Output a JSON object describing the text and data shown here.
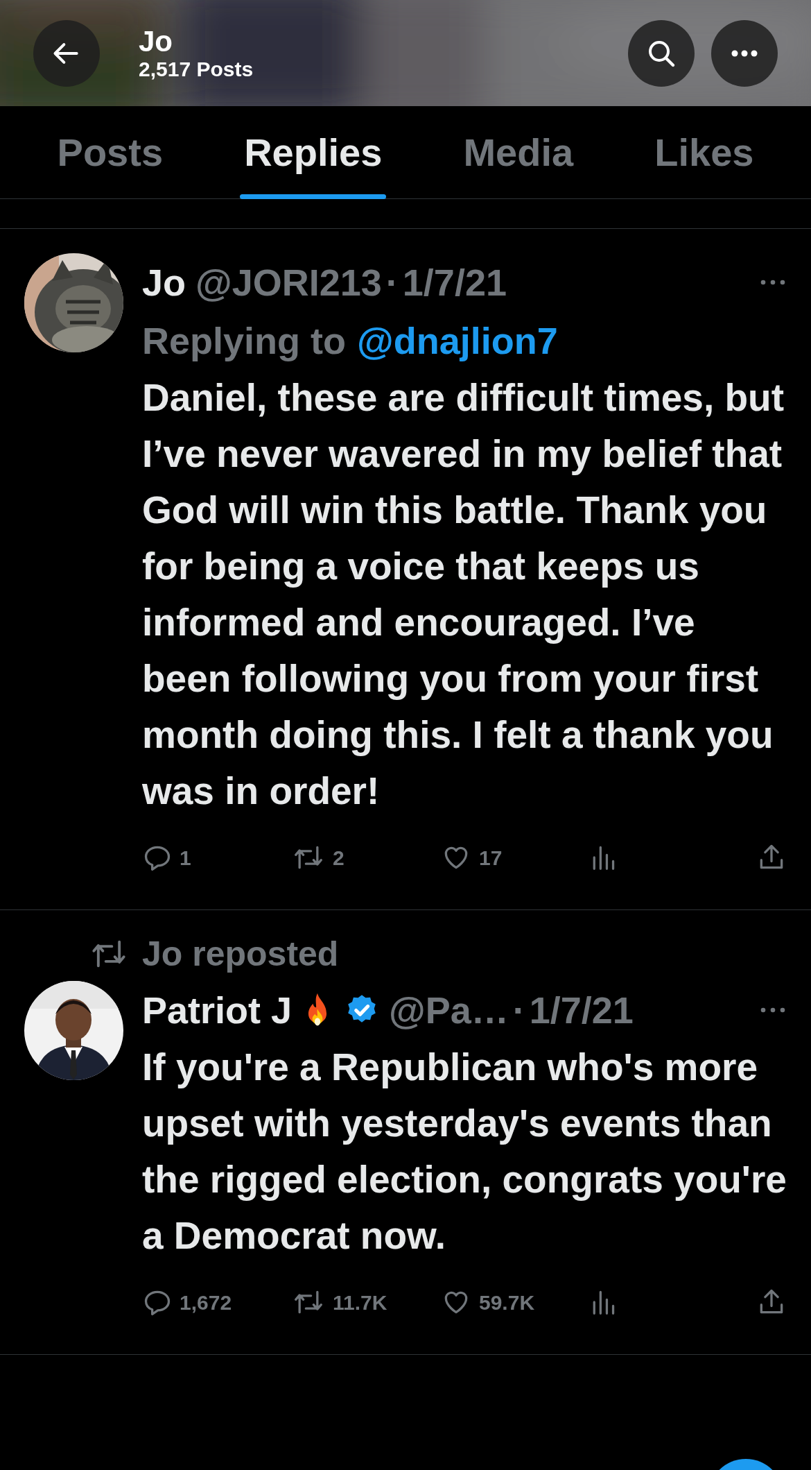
{
  "header": {
    "title": "Jo",
    "subtitle": "2,517 Posts"
  },
  "tabs": [
    {
      "label": "Posts",
      "selected": false
    },
    {
      "label": "Replies",
      "selected": true
    },
    {
      "label": "Media",
      "selected": false
    },
    {
      "label": "Likes",
      "selected": false
    }
  ],
  "posts": [
    {
      "kind": "reply",
      "author": "Jo",
      "handle": "@JORI213",
      "separator": "·",
      "date": "1/7/21",
      "replying_label": "Replying to",
      "replying_to": "@dnajlion7",
      "text": "Daniel, these are difficult times, but I’ve never wavered in my belief that God will win this battle. Thank you for being a voice that keeps us informed and encouraged. I’ve been following you from your first month doing this. I felt a thank you was in order!",
      "replies": "1",
      "reposts": "2",
      "likes": "17"
    },
    {
      "kind": "repost",
      "repost_label": "Jo reposted",
      "author": "Patriot J",
      "verified": true,
      "handle": "@Pa…",
      "separator": "·",
      "date": "1/7/21",
      "text": "If you're a Republican who's more upset with yesterday's events than the rigged election, congrats you're a Democrat now.",
      "replies": "1,672",
      "reposts": "11.7K",
      "likes": "59.7K"
    }
  ]
}
